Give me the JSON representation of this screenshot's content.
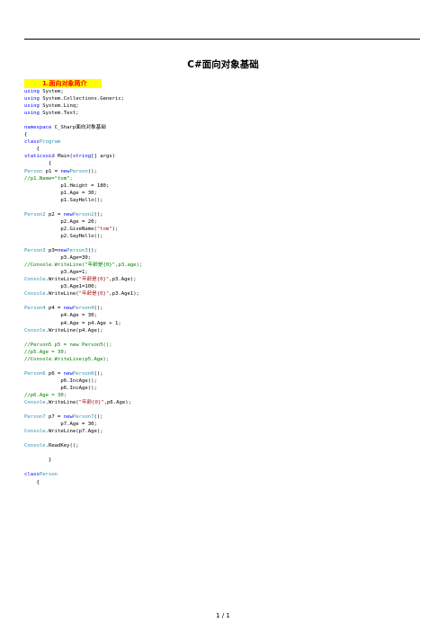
{
  "title": "C#面向对象基础",
  "section_heading": "1.面向对象简介",
  "code_lines": [
    [
      {
        "t": "using",
        "c": "kw"
      },
      {
        "t": " System;"
      }
    ],
    [
      {
        "t": "using",
        "c": "kw"
      },
      {
        "t": " System.Collections.Generic;"
      }
    ],
    [
      {
        "t": "using",
        "c": "kw"
      },
      {
        "t": " System.Linq;"
      }
    ],
    [
      {
        "t": "using",
        "c": "kw"
      },
      {
        "t": " System.Text;"
      }
    ],
    [],
    [
      {
        "t": "namespace",
        "c": "kw"
      },
      {
        "t": " C_Sharp面向对象基础"
      }
    ],
    [
      {
        "t": "{"
      }
    ],
    [
      {
        "t": "class",
        "c": "kw"
      },
      {
        "t": "Program",
        "c": "ty"
      }
    ],
    [
      {
        "t": "    {"
      }
    ],
    [
      {
        "t": "static",
        "c": "kw"
      },
      {
        "t": "void",
        "c": "kw"
      },
      {
        "t": " Main("
      },
      {
        "t": "string",
        "c": "kw"
      },
      {
        "t": "[] args)"
      }
    ],
    [
      {
        "t": "        {"
      }
    ],
    [
      {
        "t": "Person",
        "c": "ty"
      },
      {
        "t": " p1 = "
      },
      {
        "t": "new",
        "c": "kw"
      },
      {
        "t": "Person",
        "c": "ty"
      },
      {
        "t": "();"
      }
    ],
    [
      {
        "t": "//p1.Name=\"tom\";",
        "c": "cm"
      }
    ],
    [
      {
        "t": "            p1.Height = 180;"
      }
    ],
    [
      {
        "t": "            p1.Age = 30;"
      }
    ],
    [
      {
        "t": "            p1.SayHello();"
      }
    ],
    [],
    [
      {
        "t": "Person2",
        "c": "ty"
      },
      {
        "t": " p2 = "
      },
      {
        "t": "new",
        "c": "kw"
      },
      {
        "t": "Person2",
        "c": "ty"
      },
      {
        "t": "();"
      }
    ],
    [
      {
        "t": "            p2.Age = 20;"
      }
    ],
    [
      {
        "t": "            p2.GiveName("
      },
      {
        "t": "\"tom\"",
        "c": "st"
      },
      {
        "t": ");"
      }
    ],
    [
      {
        "t": "            p2.SayHello();"
      }
    ],
    [],
    [
      {
        "t": "Person3",
        "c": "ty"
      },
      {
        "t": " p3="
      },
      {
        "t": "new",
        "c": "kw"
      },
      {
        "t": "Person3",
        "c": "ty"
      },
      {
        "t": "();"
      }
    ],
    [
      {
        "t": "            p3.Age=30;"
      }
    ],
    [
      {
        "t": "//Console.WriteLine(\"年龄是{0}\",p3.age);",
        "c": "cm"
      }
    ],
    [
      {
        "t": "            p3.Age=1;"
      }
    ],
    [
      {
        "t": "Console",
        "c": "ty"
      },
      {
        "t": ".WriteLine("
      },
      {
        "t": "\"年龄是{0}\"",
        "c": "st"
      },
      {
        "t": ",p3.Age);"
      }
    ],
    [
      {
        "t": "            p3.Age1=100;"
      }
    ],
    [
      {
        "t": "Console",
        "c": "ty"
      },
      {
        "t": ".WriteLine("
      },
      {
        "t": "\"年龄是{0}\"",
        "c": "st"
      },
      {
        "t": ",p3.Age1);"
      }
    ],
    [],
    [
      {
        "t": "Person4",
        "c": "ty"
      },
      {
        "t": " p4 = "
      },
      {
        "t": "new",
        "c": "kw"
      },
      {
        "t": "Person4",
        "c": "ty"
      },
      {
        "t": "();"
      }
    ],
    [
      {
        "t": "            p4.Age = 30;"
      }
    ],
    [
      {
        "t": "            p4.Age = p4.Age + 1;"
      }
    ],
    [
      {
        "t": "Console",
        "c": "ty"
      },
      {
        "t": ".WriteLine(p4.Age);"
      }
    ],
    [],
    [
      {
        "t": "//Person5 p5 = new Person5();",
        "c": "cm"
      }
    ],
    [
      {
        "t": "//p5.Age = 30;",
        "c": "cm"
      }
    ],
    [
      {
        "t": "//Console.WriteLine(p5.Age);",
        "c": "cm"
      }
    ],
    [],
    [
      {
        "t": "Person6",
        "c": "ty"
      },
      {
        "t": " p6 = "
      },
      {
        "t": "new",
        "c": "kw"
      },
      {
        "t": "Person6",
        "c": "ty"
      },
      {
        "t": "();"
      }
    ],
    [
      {
        "t": "            p6.IncAge();"
      }
    ],
    [
      {
        "t": "            p6.IncAge();"
      }
    ],
    [
      {
        "t": "//p6.Age = 30;",
        "c": "cm"
      }
    ],
    [
      {
        "t": "Console",
        "c": "ty"
      },
      {
        "t": ".WriteLine("
      },
      {
        "t": "\"年龄{0}\"",
        "c": "st"
      },
      {
        "t": ",p6.Age);"
      }
    ],
    [],
    [
      {
        "t": "Person7",
        "c": "ty"
      },
      {
        "t": " p7 = "
      },
      {
        "t": "new",
        "c": "kw"
      },
      {
        "t": "Person7",
        "c": "ty"
      },
      {
        "t": "();"
      }
    ],
    [
      {
        "t": "            p7.Age = 30;"
      }
    ],
    [
      {
        "t": "Console",
        "c": "ty"
      },
      {
        "t": ".WriteLine(p7.Age);"
      }
    ],
    [],
    [
      {
        "t": "Console",
        "c": "ty"
      },
      {
        "t": ".ReadKey();"
      }
    ],
    [],
    [
      {
        "t": "        }"
      }
    ],
    [],
    [
      {
        "t": "class",
        "c": "kw"
      },
      {
        "t": "Person",
        "c": "ty"
      }
    ],
    [
      {
        "t": "    {"
      }
    ]
  ],
  "page_number": "1 / 1"
}
